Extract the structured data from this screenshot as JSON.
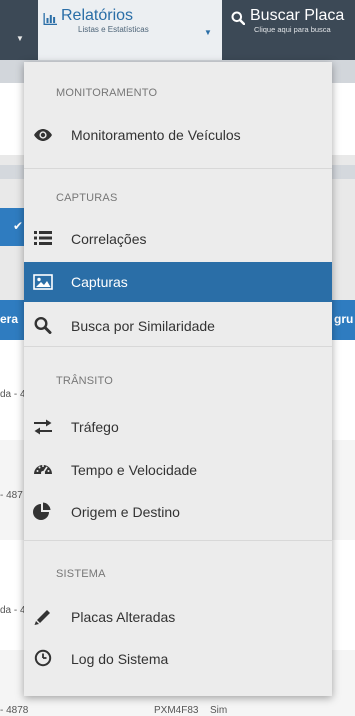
{
  "navbar": {
    "relatorios_title": "Relatórios",
    "relatorios_subtitle": "Listas e Estatísticas",
    "busca_title": "Buscar Placa",
    "busca_subtitle": "Clique aqui para busca"
  },
  "background": {
    "col_left": "era",
    "col_right": "gru",
    "rows": [
      {
        "text": "da - 4"
      },
      {
        "text": "- 487"
      },
      {
        "text": "da - 4"
      },
      {
        "text": "- 4878",
        "plate": "PXM4F83",
        "flag": "Sim"
      }
    ]
  },
  "menu": {
    "sections": [
      {
        "title": "MONITORAMENTO",
        "items": [
          {
            "label": "Monitoramento de Veículos",
            "icon": "eye-icon"
          }
        ]
      },
      {
        "title": "CAPTURAS",
        "items": [
          {
            "label": "Correlações",
            "icon": "list-icon"
          },
          {
            "label": "Capturas",
            "icon": "image-icon",
            "active": true
          },
          {
            "label": "Busca por Similaridade",
            "icon": "search-icon"
          }
        ]
      },
      {
        "title": "TRÂNSITO",
        "items": [
          {
            "label": "Tráfego",
            "icon": "exchange-icon"
          },
          {
            "label": "Tempo e Velocidade",
            "icon": "dashboard-icon"
          },
          {
            "label": "Origem e Destino",
            "icon": "pie-chart-icon"
          }
        ]
      },
      {
        "title": "SISTEMA",
        "items": [
          {
            "label": "Placas Alteradas",
            "icon": "pencil-icon"
          },
          {
            "label": "Log do Sistema",
            "icon": "clock-icon"
          }
        ]
      }
    ]
  },
  "colors": {
    "navbar": "#3c4956",
    "accent": "#2a6ea7",
    "menu_bg": "#ececec",
    "table_header": "#2f7cc0"
  }
}
